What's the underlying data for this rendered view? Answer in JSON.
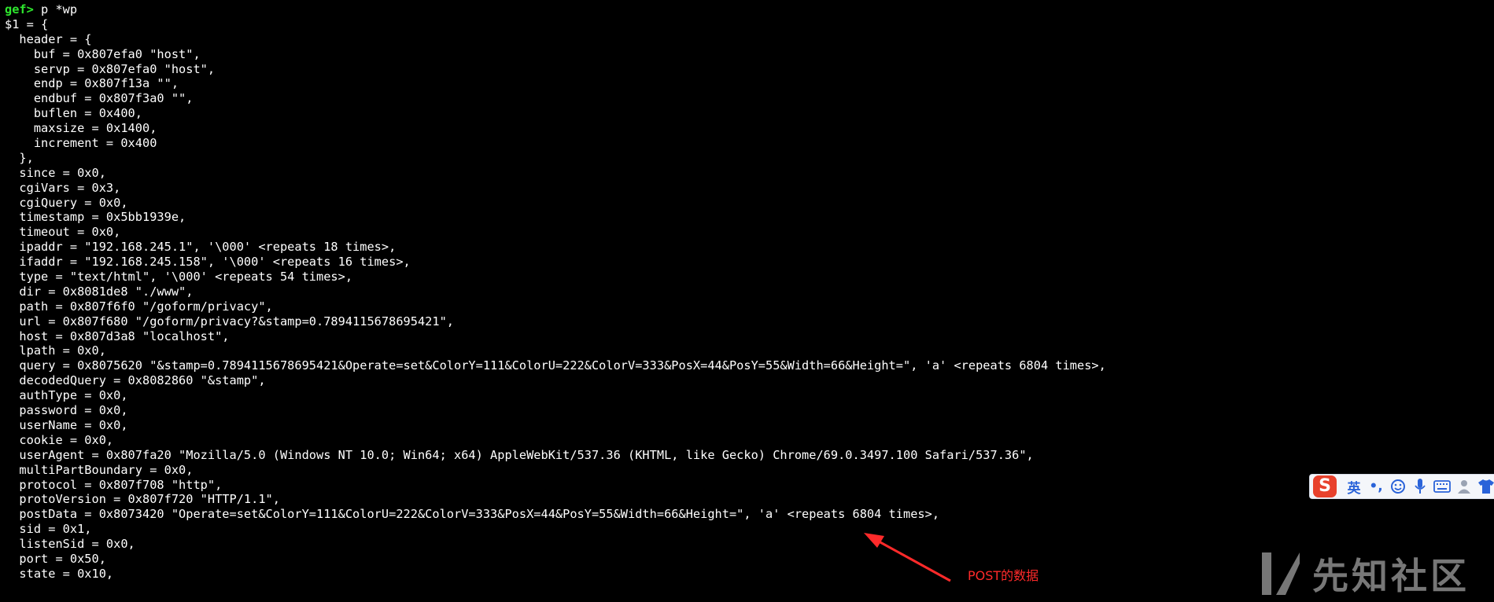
{
  "terminal": {
    "prompt": "gef>",
    "command": " p *wp",
    "lines": [
      "$1 = {",
      "  header = {",
      "    buf = 0x807efa0 \"host\",",
      "    servp = 0x807efa0 \"host\",",
      "    endp = 0x807f13a \"\",",
      "    endbuf = 0x807f3a0 \"\",",
      "    buflen = 0x400,",
      "    maxsize = 0x1400,",
      "    increment = 0x400",
      "  },",
      "  since = 0x0,",
      "  cgiVars = 0x3,",
      "  cgiQuery = 0x0,",
      "  timestamp = 0x5bb1939e,",
      "  timeout = 0x0,",
      "  ipaddr = \"192.168.245.1\", '\\000' <repeats 18 times>,",
      "  ifaddr = \"192.168.245.158\", '\\000' <repeats 16 times>,",
      "  type = \"text/html\", '\\000' <repeats 54 times>,",
      "  dir = 0x8081de8 \"./www\",",
      "  path = 0x807f6f0 \"/goform/privacy\",",
      "  url = 0x807f680 \"/goform/privacy?&stamp=0.7894115678695421\",",
      "  host = 0x807d3a8 \"localhost\",",
      "  lpath = 0x0,",
      "  query = 0x8075620 \"&stamp=0.7894115678695421&Operate=set&ColorY=111&ColorU=222&ColorV=333&PosX=44&PosY=55&Width=66&Height=\", 'a' <repeats 6804 times>,",
      "  decodedQuery = 0x8082860 \"&stamp\",",
      "  authType = 0x0,",
      "  password = 0x0,",
      "  userName = 0x0,",
      "  cookie = 0x0,",
      "  userAgent = 0x807fa20 \"Mozilla/5.0 (Windows NT 10.0; Win64; x64) AppleWebKit/537.36 (KHTML, like Gecko) Chrome/69.0.3497.100 Safari/537.36\",",
      "  multiPartBoundary = 0x0,",
      "  protocol = 0x807f708 \"http\",",
      "  protoVersion = 0x807f720 \"HTTP/1.1\",",
      "  postData = 0x8073420 \"Operate=set&ColorY=111&ColorU=222&ColorV=333&PosX=44&PosY=55&Width=66&Height=\", 'a' <repeats 6804 times>,",
      "  sid = 0x1,",
      "  listenSid = 0x0,",
      "  port = 0x50,",
      "  state = 0x10,"
    ]
  },
  "annotation": {
    "label": "POST的数据",
    "color": "#ff2a2a"
  },
  "ime_toolbar": {
    "logo": "S",
    "mode_label": "英",
    "punct_label": "•,",
    "icons": [
      "emoji-icon",
      "microphone-icon",
      "keyboard-icon",
      "user-icon",
      "shirt-icon"
    ],
    "accent": "#2a63d9"
  },
  "watermark": {
    "text": "先知社区"
  },
  "colors": {
    "background": "#000000",
    "text": "#ffffff",
    "prompt": "#2ee62e"
  }
}
